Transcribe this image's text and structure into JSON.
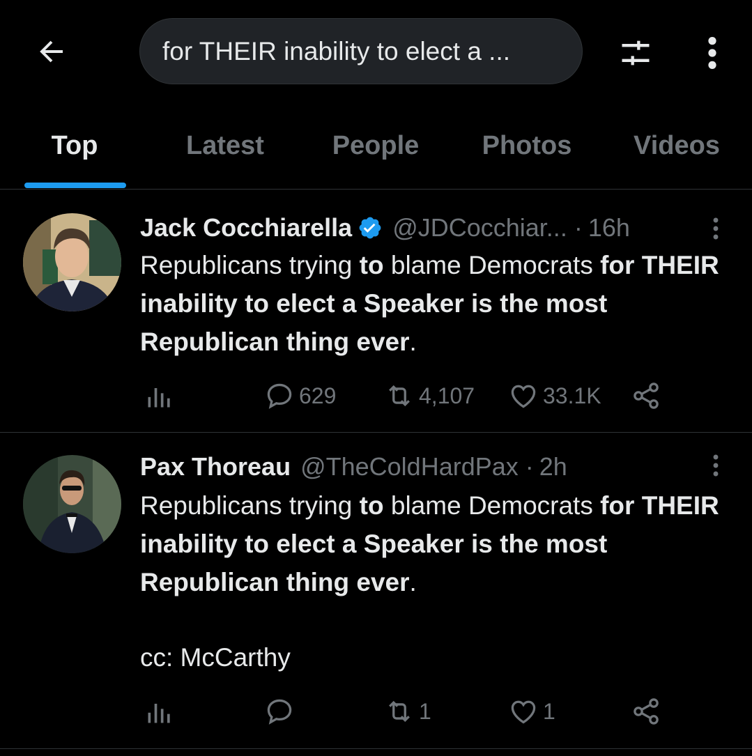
{
  "search": {
    "query": "for THEIR inability to elect a ..."
  },
  "tabs": [
    {
      "label": "Top",
      "active": true
    },
    {
      "label": "Latest"
    },
    {
      "label": "People"
    },
    {
      "label": "Photos"
    },
    {
      "label": "Videos"
    }
  ],
  "colors": {
    "accent": "#1d9bf0",
    "muted": "#71767b",
    "text": "#e7e9ea",
    "background": "#000000"
  },
  "icons": {
    "back": "arrow-left-icon",
    "filter": "sliders-icon",
    "more": "vertical-dots-icon",
    "verified": "verified-badge-icon",
    "views": "bar-chart-icon",
    "reply": "speech-bubble-icon",
    "retweet": "retweet-arrows-icon",
    "like": "heart-icon",
    "share": "share-nodes-icon"
  },
  "tweets": [
    {
      "name": "Jack Cocchiarella",
      "verified": true,
      "handle": "@JDCocchiar...",
      "dot": "·",
      "time": "16h",
      "text_parts": [
        "Republicans trying ",
        "to",
        " blame Democrats ",
        "for",
        "THEIR inability to elect a Speaker is the most Republican thing ever",
        "."
      ],
      "replies": "629",
      "retweets": "4,107",
      "likes": "33.1K"
    },
    {
      "name": "Pax Thoreau",
      "verified": false,
      "handle": "@TheColdHardPax",
      "dot": "·",
      "time": "2h",
      "text_parts": [
        "Republicans trying ",
        "to",
        " blame Democrats ",
        "for",
        "THEIR inability to elect a Speaker is the most Republican thing ever",
        "."
      ],
      "cc": "cc: McCarthy",
      "replies": "",
      "retweets": "1",
      "likes": "1"
    }
  ]
}
